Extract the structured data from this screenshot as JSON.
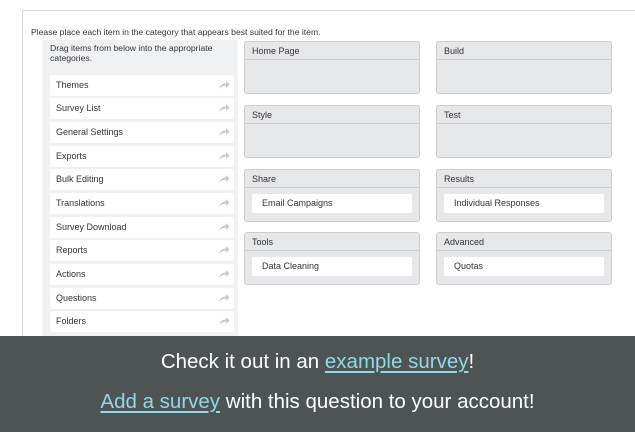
{
  "question": {
    "instruction": "Please place each item in the category that appears best suited for the item."
  },
  "source": {
    "label": "Drag items from below into the appropriate categories.",
    "items": [
      {
        "label": "Themes"
      },
      {
        "label": "Survey List"
      },
      {
        "label": "General Settings"
      },
      {
        "label": "Exports"
      },
      {
        "label": "Bulk Editing"
      },
      {
        "label": "Translations"
      },
      {
        "label": "Survey Download"
      },
      {
        "label": "Reports"
      },
      {
        "label": "Actions"
      },
      {
        "label": "Questions"
      },
      {
        "label": "Folders"
      }
    ],
    "item_icon": "share-arrow-icon"
  },
  "buckets": [
    {
      "title": "Home Page",
      "items": []
    },
    {
      "title": "Build",
      "items": []
    },
    {
      "title": "Style",
      "items": []
    },
    {
      "title": "Test",
      "items": []
    },
    {
      "title": "Share",
      "items": [
        {
          "label": "Email Campaigns"
        }
      ]
    },
    {
      "title": "Results",
      "items": [
        {
          "label": "Individual Responses"
        }
      ]
    },
    {
      "title": "Tools",
      "items": [
        {
          "label": "Data Cleaning"
        }
      ]
    },
    {
      "title": "Advanced",
      "items": [
        {
          "label": "Quotas"
        }
      ]
    }
  ],
  "banner": {
    "line1_prefix": "Check it out in an ",
    "line1_link": "example survey",
    "line1_suffix": "!",
    "line2_link": "Add a survey",
    "line2_suffix": " with this question to your account!"
  },
  "colors": {
    "banner_bg": "#4e5353",
    "link": "#8fd9e6",
    "bucket_bg": "#e6e7e9",
    "source_bg": "#f0f1f3"
  }
}
